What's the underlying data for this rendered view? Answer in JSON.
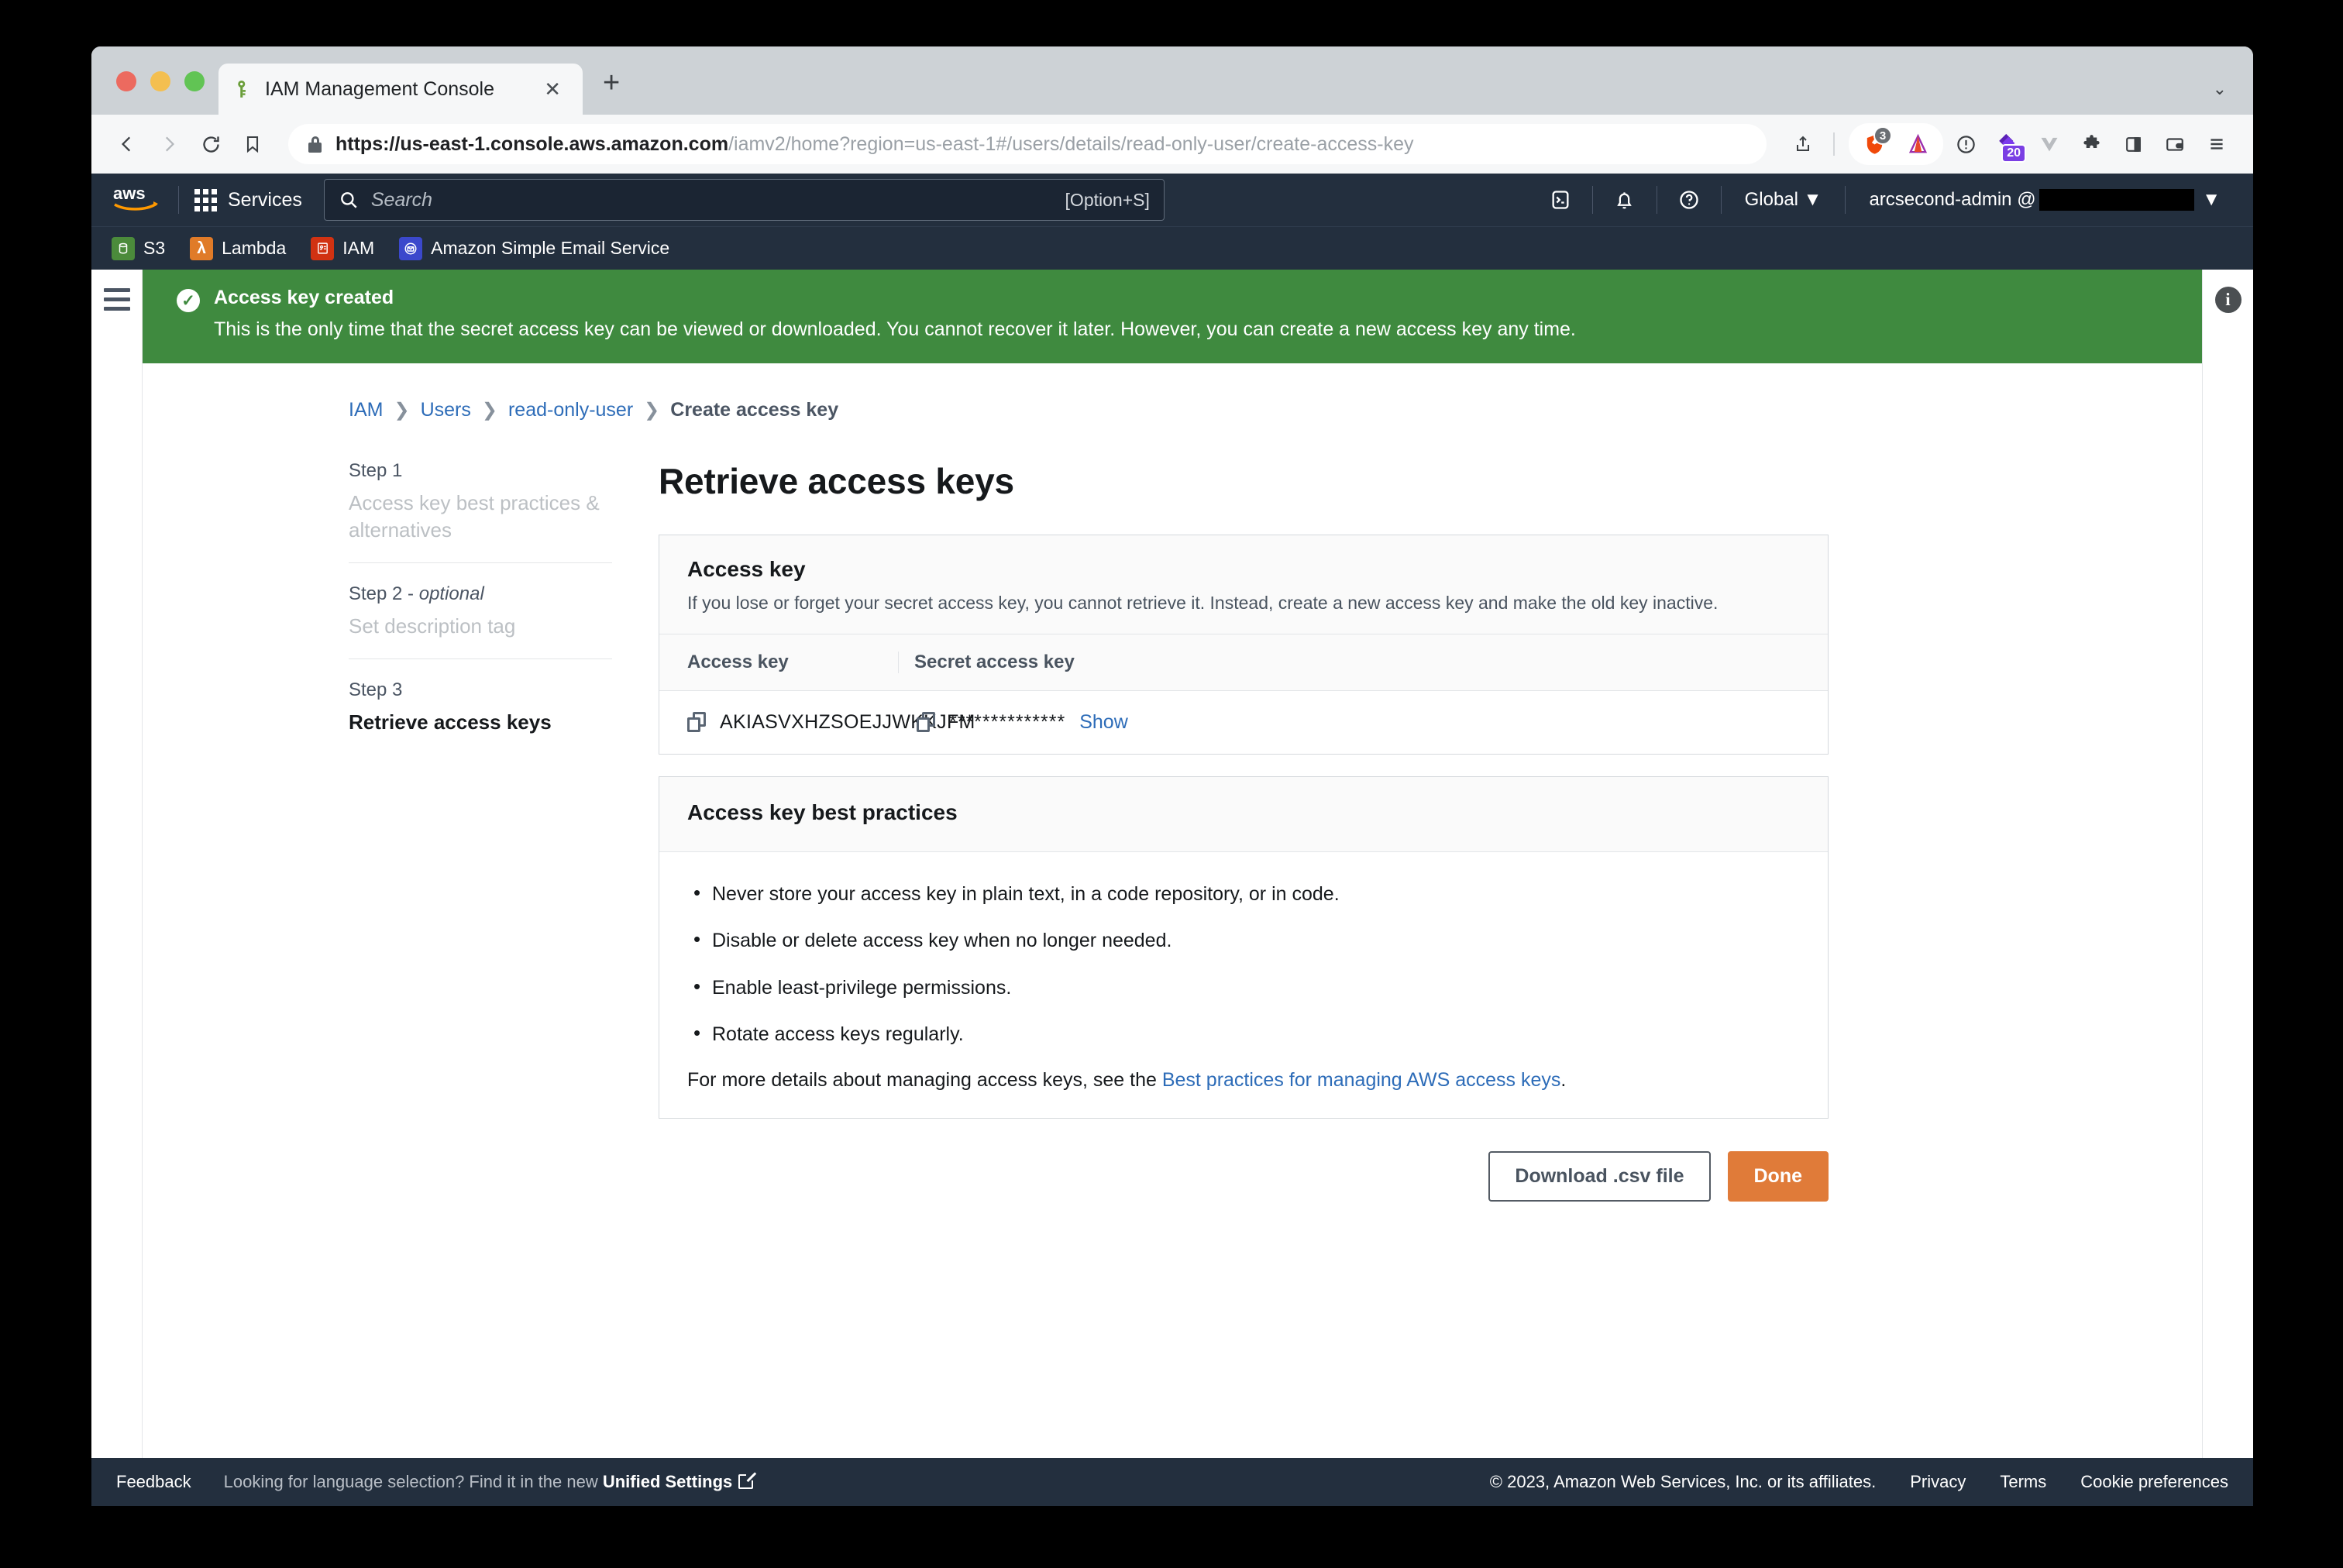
{
  "browser": {
    "tab": {
      "title": "IAM Management Console",
      "favicon": "key-icon",
      "close": "✕"
    },
    "new_tab": "+",
    "tab_list_chevron": "⌄",
    "address": {
      "scheme_host": "https://us-east-1.console.aws.amazon.com",
      "path": "/iamv2/home?region=us-east-1#/users/details/read-only-user/create-access-key",
      "full": "https://us-east-1.console.aws.amazon.com/iamv2/home?region=us-east-1#/users/details/read-only-user/create-access-key"
    },
    "toolbar_icons": [
      {
        "name": "share-icon",
        "glyph": "↥"
      },
      {
        "name": "brave-shields-icon",
        "badge": "3"
      },
      {
        "name": "brave-rewards-icon",
        "glyph": "▲"
      },
      {
        "name": "password-manager-icon",
        "glyph": "!"
      },
      {
        "name": "extension-purple-icon",
        "badge": "20"
      },
      {
        "name": "vue-devtools-icon",
        "glyph": "V"
      },
      {
        "name": "extensions-puzzle-icon",
        "glyph": "🧩"
      },
      {
        "name": "sidebar-icon",
        "glyph": "▯"
      },
      {
        "name": "brave-wallet-icon",
        "glyph": "▤"
      },
      {
        "name": "browser-menu-icon",
        "glyph": "≡"
      }
    ]
  },
  "aws_nav": {
    "logo": "aws",
    "services_label": "Services",
    "search_placeholder": "Search",
    "search_shortcut": "[Option+S]",
    "cloudshell_icon": "cloudshell-icon",
    "notifications_icon": "bell-icon",
    "help_icon": "help-icon",
    "region": "Global",
    "region_caret": "▼",
    "account": "arcsecond-admin @",
    "account_caret": "▼"
  },
  "favorites": [
    {
      "label": "S3",
      "icon": "s3-icon",
      "color": "#4b8b3b",
      "glyph": "▤"
    },
    {
      "label": "Lambda",
      "icon": "lambda-icon",
      "color": "#e07b28",
      "glyph": "λ"
    },
    {
      "label": "IAM",
      "icon": "iam-icon",
      "color": "#d13212",
      "glyph": "▤"
    },
    {
      "label": "Amazon Simple Email Service",
      "icon": "ses-icon",
      "color": "#3b48cc",
      "glyph": "✉"
    }
  ],
  "banner": {
    "icon": "success-check-icon",
    "title": "Access key created",
    "text": "This is the only time that the secret access key can be viewed or downloaded. You cannot recover it later. However, you can create a new access key any time.",
    "color": "#3f8a3f"
  },
  "breadcrumb": [
    {
      "label": "IAM",
      "current": false
    },
    {
      "label": "Users",
      "current": false
    },
    {
      "label": "read-only-user",
      "current": false
    },
    {
      "label": "Create access key",
      "current": true
    }
  ],
  "breadcrumb_separator": "❯",
  "steps": [
    {
      "num": "Step 1",
      "optional": "",
      "name": "Access key best practices & alternatives",
      "active": false
    },
    {
      "num": "Step 2 - ",
      "optional": "optional",
      "name": "Set description tag",
      "active": false
    },
    {
      "num": "Step 3",
      "optional": "",
      "name": "Retrieve access keys",
      "active": true
    }
  ],
  "page": {
    "title": "Retrieve access keys"
  },
  "access_key_card": {
    "title": "Access key",
    "description": "If you lose or forget your secret access key, you cannot retrieve it. Instead, create a new access key and make the old key inactive.",
    "columns": [
      "Access key",
      "Secret access key"
    ],
    "row": {
      "access_key": "AKIASVXHZSOEJJWKKJFM",
      "secret_masked": "**************",
      "show_label": "Show",
      "copy_icon": "copy-icon"
    }
  },
  "best_practices_card": {
    "title": "Access key best practices",
    "items": [
      "Never store your access key in plain text, in a code repository, or in code.",
      "Disable or delete access key when no longer needed.",
      "Enable least-privilege permissions.",
      "Rotate access keys regularly."
    ],
    "footer_prefix": "For more details about managing access keys, see the ",
    "footer_link": "Best practices for managing AWS access keys",
    "footer_suffix": "."
  },
  "actions": {
    "download_label": "Download .csv file",
    "done_label": "Done",
    "primary_color": "#e07b39"
  },
  "info_panel_icon": "info-icon",
  "nav_menu_icon": "hamburger-icon",
  "footer": {
    "feedback": "Feedback",
    "language_prefix": "Looking for language selection? Find it in the new ",
    "language_link": "Unified Settings",
    "external_icon": "external-link-icon",
    "copyright": "© 2023, Amazon Web Services, Inc. or its affiliates.",
    "links": [
      "Privacy",
      "Terms",
      "Cookie preferences"
    ]
  }
}
